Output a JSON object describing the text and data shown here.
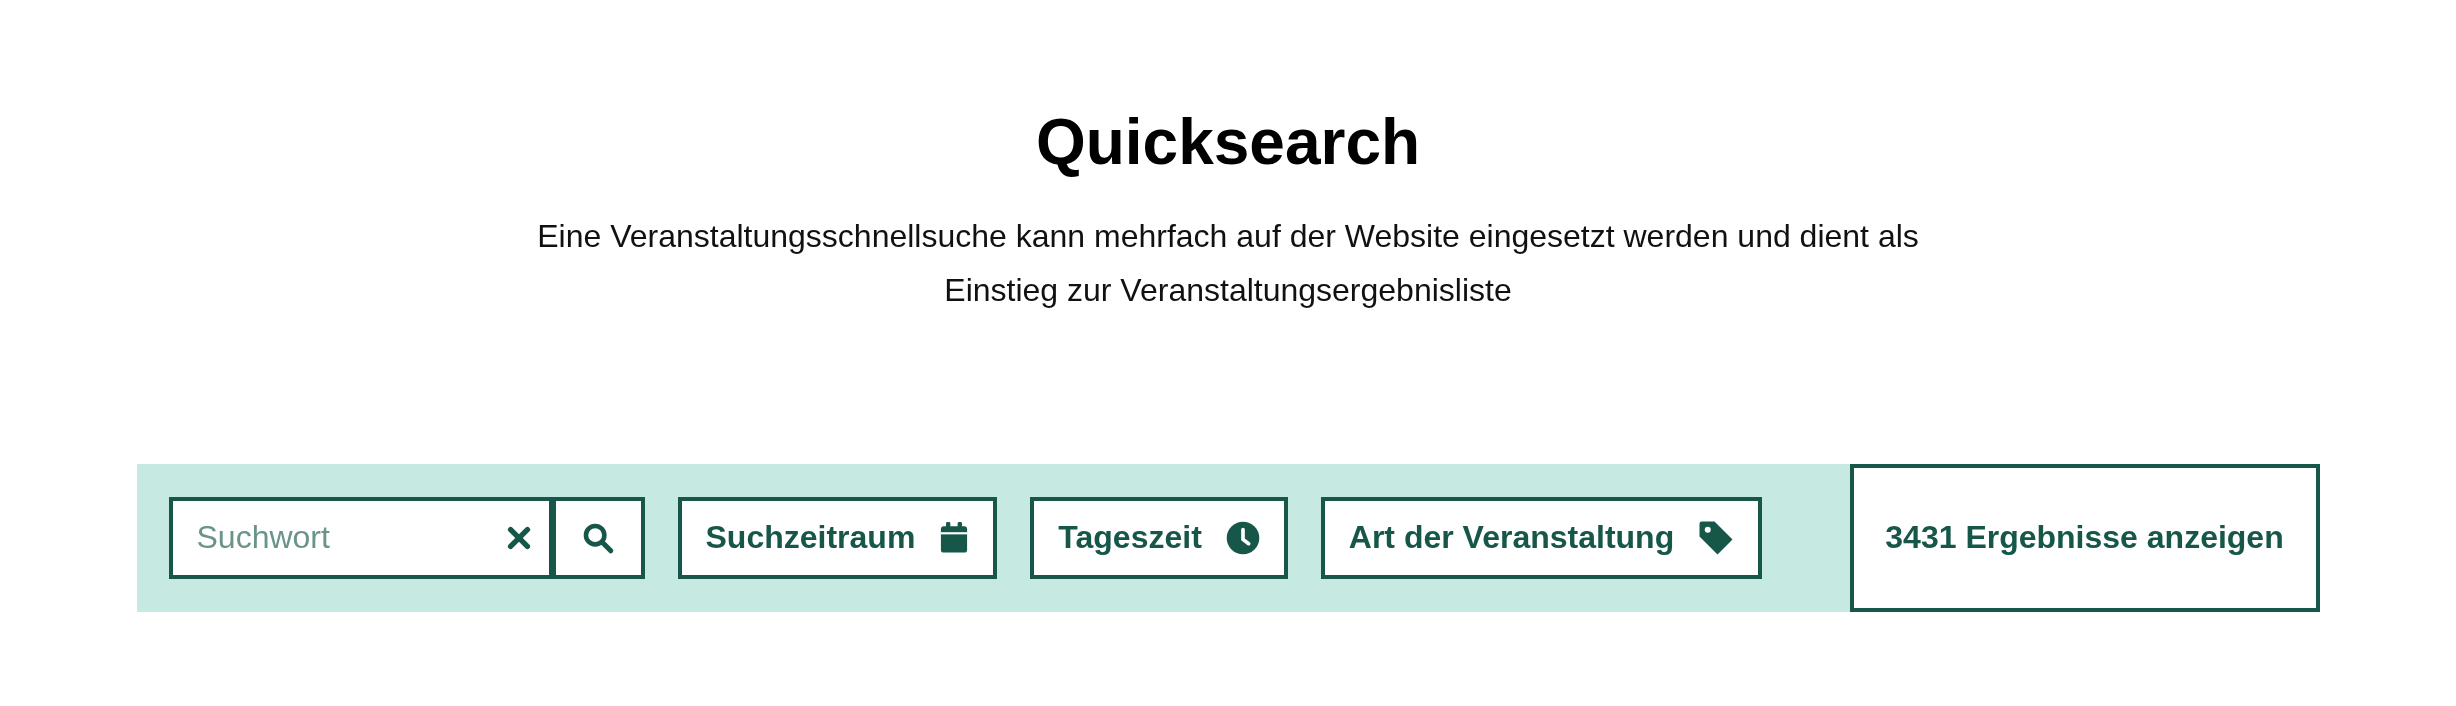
{
  "title": "Quicksearch",
  "description": "Eine Veranstaltungsschnellsuche kann mehrfach auf der Website eingesetzt werden und dient als Einstieg zur Veranstaltungsergebnisliste",
  "search": {
    "placeholder": "Suchwort"
  },
  "filters": [
    {
      "label": "Suchzeitraum",
      "kind": "calendar"
    },
    {
      "label": "Tageszeit",
      "kind": "clock"
    },
    {
      "label": "Art der Veranstaltung",
      "kind": "tag"
    }
  ],
  "results_button": "3431 Ergebnisse anzeigen"
}
